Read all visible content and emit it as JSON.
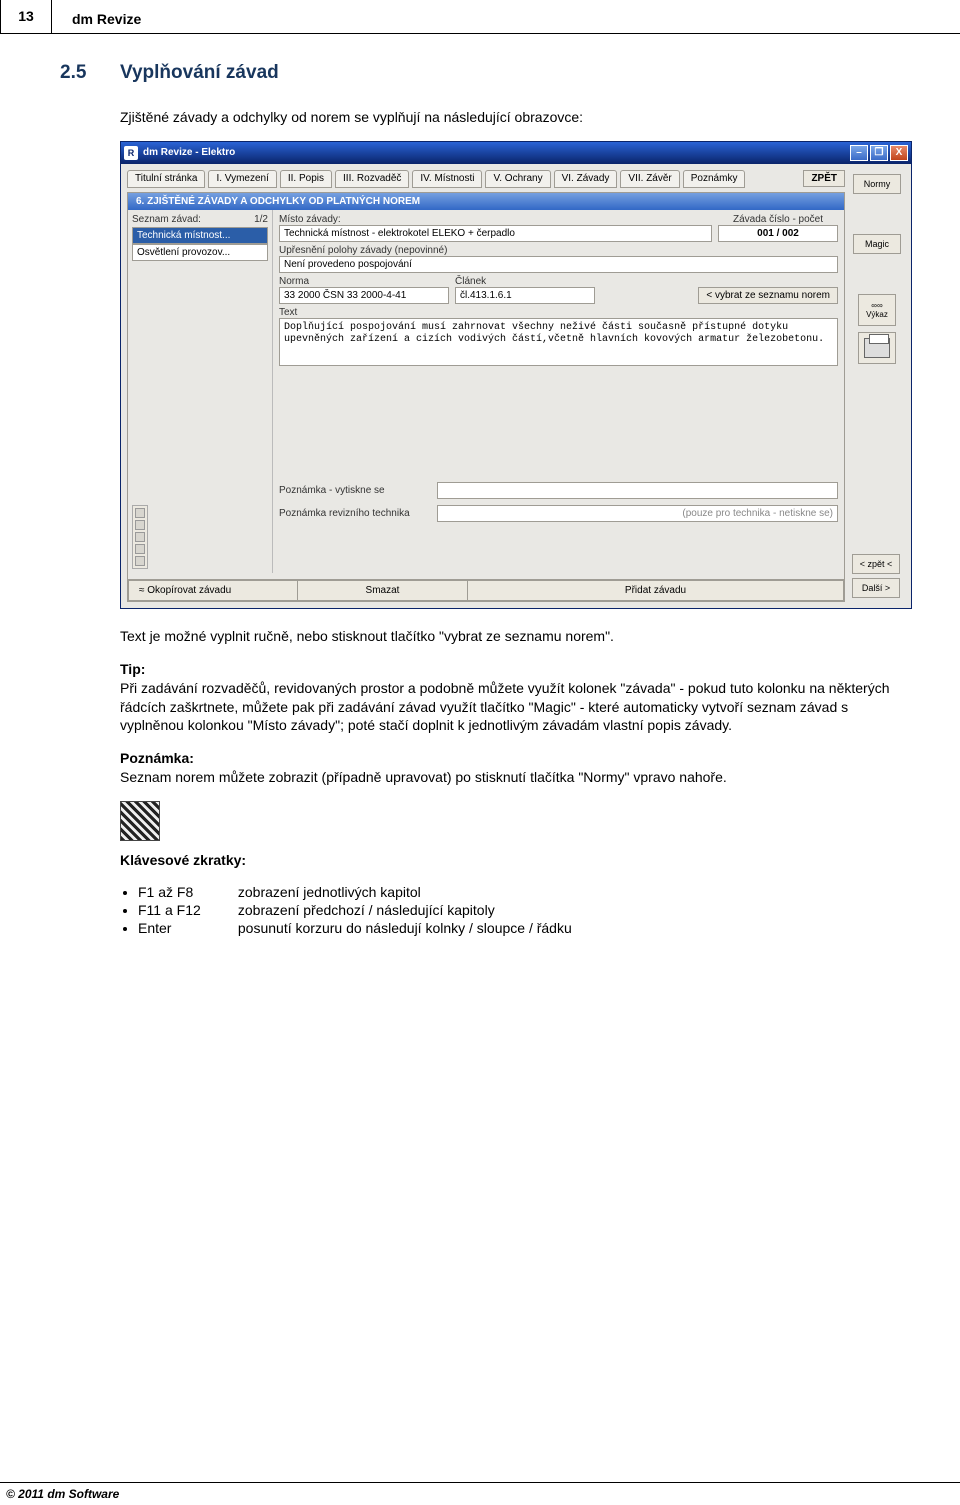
{
  "page": {
    "num": "13",
    "title": "dm Revize"
  },
  "section": {
    "num": "2.5",
    "title": "Vyplňování závad"
  },
  "intro": "Zjištěné závady a odchylky od norem se vyplňují na následující obrazovce:",
  "after_img": "Text je možné vyplnit ručně, nebo stisknout tlačítko \"vybrat ze seznamu norem\".",
  "tip_heading": "Tip:",
  "tip_body": "Při zadávání rozvaděčů, revidovaných prostor a podobně můžete využít kolonek \"závada\" - pokud tuto kolonku na některých řádcích zaškrtnete, můžete pak při zadávání závad využít tlačítko \"Magic\" - které automaticky vytvoří seznam závad s vyplněnou kolonkou \"Místo závady\"; poté stačí doplnit k jednotlivým závadám vlastní popis závady.",
  "note_heading": "Poznámka:",
  "note_body": "Seznam norem můžete zobrazit (případně upravovat) po stisknutí tlačítka \"Normy\" vpravo nahoře.",
  "shortcuts": {
    "heading": "Klávesové zkratky:",
    "items": [
      {
        "keys": "F1 až F8",
        "desc": "zobrazení jednotlivých kapitol"
      },
      {
        "keys": "F11 a F12",
        "desc": "zobrazení předchozí / následující kapitoly"
      },
      {
        "keys": "Enter",
        "desc": "posunutí korzuru do následují kolnky / sloupce / řádku"
      }
    ]
  },
  "window": {
    "title": "dm Revize - Elektro",
    "app_icon": "R",
    "controls": {
      "min": "–",
      "max": "❐",
      "close": "X"
    },
    "tabs": [
      "Titulní stránka",
      "I. Vymezení",
      "II. Popis",
      "III. Rozvaděč",
      "IV. Místnosti",
      "V. Ochrany",
      "VI. Závady",
      "VII. Závěr",
      "Poznámky"
    ],
    "back_btn": "ZPĚT",
    "section_header": "6. ZJIŠTĚNÉ ZÁVADY A ODCHYLKY OD PLATNÝCH NOREM",
    "rail": {
      "normy": "Normy",
      "magic": "Magic",
      "vykaz": "Výkaz",
      "zpet": "< zpět <",
      "dalsi": "Další >"
    },
    "left": {
      "label": "Seznam závad:",
      "counter": "1/2",
      "items": [
        "Technická místnost...",
        "Osvětlení provozov..."
      ]
    },
    "form": {
      "misto_label": "Místo závady:",
      "misto_value": "Technická místnost - elektrokotel ELEKO + čerpadlo",
      "zavada_label": "Závada   číslo - počet",
      "zavada_value": "001  /  002",
      "upresneni_label": "Upřesnění polohy závady (nepovinné)",
      "upresneni_value": "Není provedeno pospojování",
      "norma_label": "Norma",
      "norma_value": "33 2000 ČSN 33 2000-4-41",
      "clanek_label": "Článek",
      "clanek_value": "čl.413.1.6.1",
      "vybrat_btn": "<  vybrat ze seznamu norem",
      "text_label": "Text",
      "text_value": "Doplňující pospojování musí zahrnovat všechny neživé části současně přístupné dotyku upevněných zařízení a cizích vodivých částí,včetně hlavních kovových armatur železobetonu.",
      "pozn1_label": "Poznámka - vytiskne se",
      "pozn2_label": "Poznámka revizního technika",
      "pozn2_hint": "(pouze pro technika - netiskne se)"
    },
    "bottom": {
      "copy": "≈  Okopírovat závadu",
      "delete": "Smazat",
      "add": "Přidat závadu"
    }
  },
  "footer": "© 2011 dm Software"
}
